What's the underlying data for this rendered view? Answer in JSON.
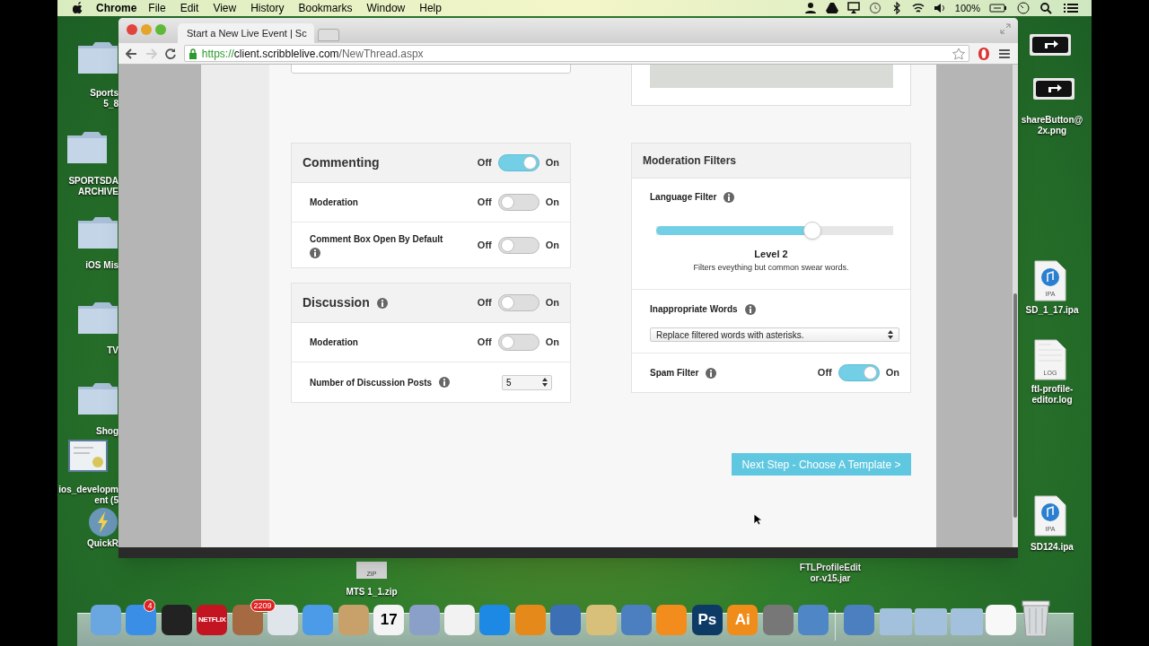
{
  "menu_bar": {
    "app": "Chrome",
    "menus": [
      "File",
      "Edit",
      "View",
      "History",
      "Bookmarks",
      "Window",
      "Help"
    ],
    "battery": "100%"
  },
  "browser": {
    "tab_title": "Start a New Live Event | Sc",
    "url": {
      "scheme": "https://",
      "host": "client.scribblelive.com",
      "path": "/NewThread.aspx"
    }
  },
  "page": {
    "commenting": {
      "title": "Commenting",
      "info": false,
      "on": true,
      "off_label": "Off",
      "on_label": "On",
      "rows": [
        {
          "kind": "toggle",
          "label": "Moderation",
          "info": false,
          "on": false,
          "off_label": "Off",
          "on_label": "On"
        },
        {
          "kind": "toggle",
          "label": "Comment Box Open By Default",
          "info": true,
          "on": false,
          "off_label": "Off",
          "on_label": "On"
        }
      ]
    },
    "discussion": {
      "title": "Discussion",
      "info": true,
      "on": false,
      "off_label": "Off",
      "on_label": "On",
      "rows": [
        {
          "kind": "toggle",
          "label": "Moderation",
          "info": false,
          "on": false,
          "off_label": "Off",
          "on_label": "On"
        },
        {
          "kind": "number",
          "label": "Number of Discussion Posts",
          "info": true,
          "value": "5"
        }
      ]
    },
    "moderation_filters": {
      "title": "Moderation Filters",
      "language_filter": {
        "label": "Language Filter",
        "level": 0.66,
        "level_name": "Level 2",
        "description": "Filters eveything but common swear words."
      },
      "inappropriate_words": {
        "label": "Inappropriate Words",
        "value": "Replace filtered words with asterisks."
      },
      "spam_filter": {
        "label": "Spam Filter",
        "on": true,
        "off_label": "Off",
        "on_label": "On"
      }
    },
    "next_button": "Next Step - Choose A Template >"
  },
  "desktop": {
    "left_icons": [
      {
        "kind": "folder",
        "lines": [
          "Sports",
          "5_8"
        ]
      },
      {
        "kind": "folder",
        "lines": [
          "SPORTSDA",
          "ARCHIVE"
        ]
      },
      {
        "kind": "folder",
        "lines": [
          "iOS Mis"
        ]
      },
      {
        "kind": "folder",
        "lines": [
          "TV"
        ]
      },
      {
        "kind": "folder",
        "lines": [
          "Shog"
        ]
      },
      {
        "kind": "certificate",
        "lines": [
          "ios_developm",
          "ent (5"
        ]
      },
      {
        "kind": "app",
        "lines": [
          "QuickR"
        ]
      }
    ],
    "right_icons": [
      {
        "kind": "share"
      },
      {
        "kind": "share",
        "lines": [
          "shareButton@",
          "2x.png"
        ]
      },
      {
        "kind": "ipa",
        "badge": "IPA",
        "lines": [
          "SD_1_17.ipa"
        ]
      },
      {
        "kind": "log",
        "badge": "LOG",
        "lines": [
          "ftl-profile-",
          "editor.log"
        ]
      },
      {
        "kind": "ipa",
        "badge": "IPA",
        "lines": [
          "SD124.ipa"
        ]
      }
    ],
    "bottom_icons": [
      {
        "kind": "zip",
        "badge": "ZIP",
        "lines": [
          "MTS 1_1.zip"
        ]
      },
      {
        "kind": "none",
        "lines": [
          "FTLProfileEdit",
          "or-v15.jar"
        ]
      }
    ]
  },
  "dock": [
    {
      "kind": "app"
    },
    {
      "kind": "app",
      "badge": "4"
    },
    {
      "kind": "app"
    },
    {
      "kind": "app",
      "text": "NETFLIX"
    },
    {
      "kind": "app",
      "badge": "2209"
    },
    {
      "kind": "app"
    },
    {
      "kind": "app"
    },
    {
      "kind": "app"
    },
    {
      "kind": "app",
      "text": "17"
    },
    {
      "kind": "app"
    },
    {
      "kind": "app"
    },
    {
      "kind": "app"
    },
    {
      "kind": "app"
    },
    {
      "kind": "app"
    },
    {
      "kind": "app"
    },
    {
      "kind": "app"
    },
    {
      "kind": "app"
    },
    {
      "kind": "app",
      "text": "Ps"
    },
    {
      "kind": "app",
      "text": "Ai"
    },
    {
      "kind": "app"
    },
    {
      "kind": "app"
    },
    {
      "kind": "divider"
    },
    {
      "kind": "app"
    },
    {
      "kind": "folder"
    },
    {
      "kind": "folder"
    },
    {
      "kind": "folder"
    },
    {
      "kind": "app"
    },
    {
      "kind": "trash"
    }
  ]
}
